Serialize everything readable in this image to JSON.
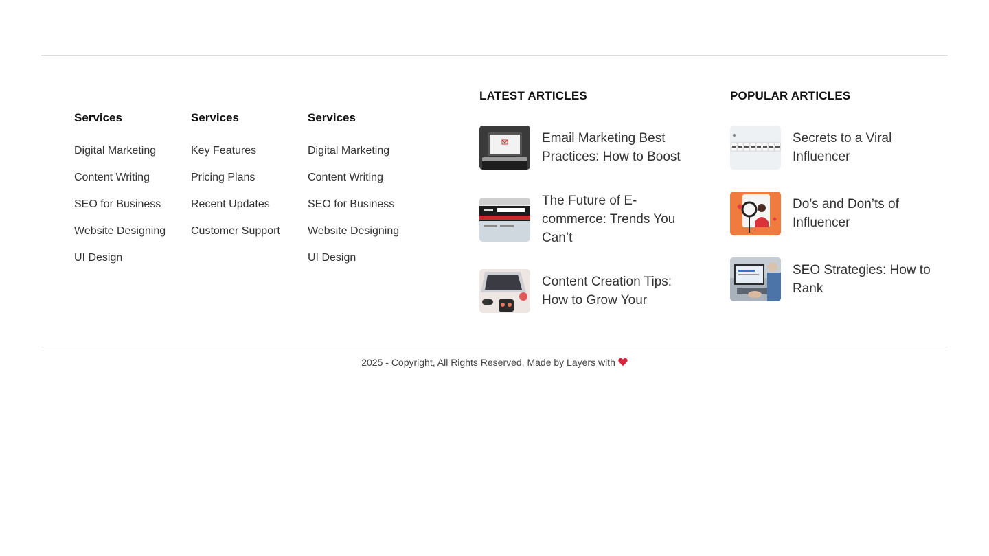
{
  "columns": [
    {
      "heading": "Services",
      "items": [
        "Digital Marketing",
        "Content Writing",
        "SEO for Business",
        "Website Designing",
        "UI Design"
      ]
    },
    {
      "heading": "Services",
      "items": [
        "Key Features",
        "Pricing Plans",
        "Recent Updates",
        "Customer Support"
      ]
    },
    {
      "heading": "Services",
      "items": [
        "Digital Marketing",
        "Content Writing",
        "SEO for Business",
        "Website Designing",
        "UI Design"
      ]
    }
  ],
  "latest": {
    "heading": "LATEST ARTICLES",
    "items": [
      {
        "title": "Email Marketing Best Practices: How to Boost",
        "icon": "laptop-email-thumbnail"
      },
      {
        "title": "The Future of E-commerce: Trends You Can’t",
        "icon": "ecommerce-screen-thumbnail"
      },
      {
        "title": "Content Creation Tips: How to Grow Your",
        "icon": "desk-laptop-thumbnail"
      }
    ]
  },
  "popular": {
    "heading": "POPULAR ARTICLES",
    "items": [
      {
        "title": "Secrets to a Viral Influencer",
        "icon": "influencer-blocks-thumbnail"
      },
      {
        "title": "Do’s and Don’ts of Influencer",
        "icon": "ring-light-thumbnail"
      },
      {
        "title": "SEO Strategies: How to Rank",
        "icon": "typing-laptop-thumbnail"
      }
    ]
  },
  "footer": {
    "copyright": "2025 - Copyright, All Rights Reserved, Made by Layers with",
    "heart_icon": "heart-icon",
    "heart_color": "#d7263d"
  }
}
